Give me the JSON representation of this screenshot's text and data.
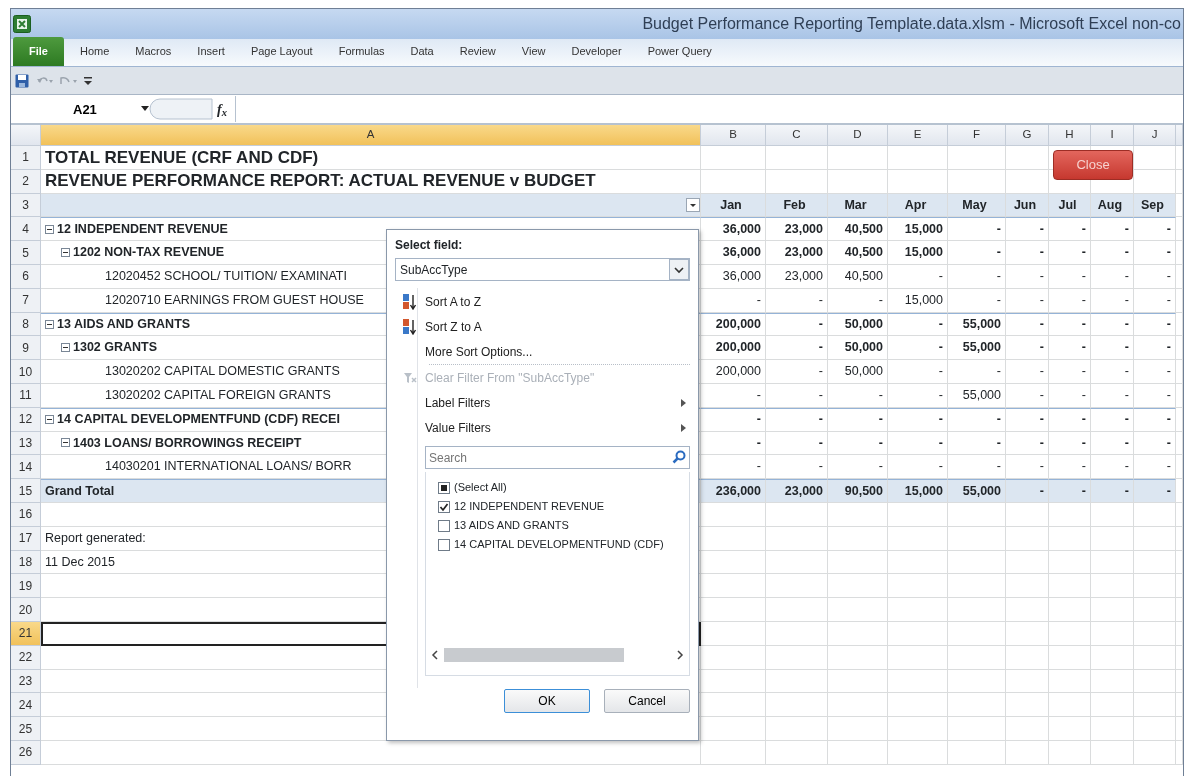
{
  "window": {
    "title": "Budget Performance Reporting Template.data.xlsm  -  Microsoft Excel non-co"
  },
  "ribbon_tabs": [
    {
      "label": "File",
      "selected": true
    },
    {
      "label": "Home",
      "selected": false
    },
    {
      "label": "Macros",
      "selected": false
    },
    {
      "label": "Insert",
      "selected": false
    },
    {
      "label": "Page Layout",
      "selected": false
    },
    {
      "label": "Formulas",
      "selected": false
    },
    {
      "label": "Data",
      "selected": false
    },
    {
      "label": "Review",
      "selected": false
    },
    {
      "label": "View",
      "selected": false
    },
    {
      "label": "Developer",
      "selected": false
    },
    {
      "label": "Power Query",
      "selected": false
    }
  ],
  "formula_bar": {
    "name_box": "A21",
    "function_label": "f$_{x}$"
  },
  "sheet": {
    "column_headers": [
      {
        "label": "A",
        "selected": true
      },
      {
        "label": "B",
        "selected": false
      },
      {
        "label": "C",
        "selected": false
      },
      {
        "label": "D",
        "selected": false
      },
      {
        "label": "E",
        "selected": false
      },
      {
        "label": "F",
        "selected": false
      },
      {
        "label": "G",
        "selected": false
      },
      {
        "label": "H",
        "selected": false
      },
      {
        "label": "I",
        "selected": false
      },
      {
        "label": "J",
        "selected": false
      }
    ],
    "row_headers": [
      {
        "label": "1",
        "selected": false
      },
      {
        "label": "2",
        "selected": false
      },
      {
        "label": "3",
        "selected": false
      },
      {
        "label": "4",
        "selected": false
      },
      {
        "label": "5",
        "selected": false
      },
      {
        "label": "6",
        "selected": false
      },
      {
        "label": "7",
        "selected": false
      },
      {
        "label": "8",
        "selected": false
      },
      {
        "label": "9",
        "selected": false
      },
      {
        "label": "10",
        "selected": false
      },
      {
        "label": "11",
        "selected": false
      },
      {
        "label": "12",
        "selected": false
      },
      {
        "label": "13",
        "selected": false
      },
      {
        "label": "14",
        "selected": false
      },
      {
        "label": "15",
        "selected": false
      },
      {
        "label": "16",
        "selected": false
      },
      {
        "label": "17",
        "selected": false
      },
      {
        "label": "18",
        "selected": false
      },
      {
        "label": "19",
        "selected": false
      },
      {
        "label": "20",
        "selected": false
      },
      {
        "label": "21",
        "selected": true
      },
      {
        "label": "22",
        "selected": false
      },
      {
        "label": "23",
        "selected": false
      },
      {
        "label": "24",
        "selected": false
      },
      {
        "label": "25",
        "selected": false
      },
      {
        "label": "26",
        "selected": false
      }
    ],
    "titles": [
      "TOTAL REVENUE (CRF AND CDF)",
      "REVENUE PERFORMANCE REPORT: ACTUAL REVENUE v BUDGET"
    ],
    "close_button": "Close",
    "pivot": {
      "months": [
        "Jan",
        "Feb",
        "Mar",
        "Apr",
        "May",
        "Jun",
        "Jul",
        "Aug",
        "Sep"
      ],
      "items": [
        {
          "label": "12  INDEPENDENT REVENUE",
          "expanded": true,
          "values": [
            "36,000",
            "23,000",
            "40,500",
            "15,000",
            "-",
            "-",
            "-",
            "-",
            "-"
          ],
          "children": [
            {
              "label": "1202  NON-TAX REVENUE",
              "expanded": true,
              "values": [
                "36,000",
                "23,000",
                "40,500",
                "15,000",
                "-",
                "-",
                "-",
                "-",
                "-"
              ],
              "children": [
                {
                  "label": "12020452  SCHOOL/ TUITION/ EXAMINATI",
                  "values": [
                    "36,000",
                    "23,000",
                    "40,500",
                    "-",
                    "-",
                    "-",
                    "-",
                    "-",
                    "-"
                  ]
                },
                {
                  "label": "12020710  EARNINGS FROM GUEST HOUSE",
                  "values": [
                    "-",
                    "-",
                    "-",
                    "15,000",
                    "-",
                    "-",
                    "-",
                    "-",
                    "-"
                  ]
                }
              ]
            }
          ]
        },
        {
          "label": "13  AIDS AND GRANTS",
          "expanded": true,
          "values": [
            "200,000",
            "-",
            "50,000",
            "-",
            "55,000",
            "-",
            "-",
            "-",
            "-"
          ],
          "children": [
            {
              "label": "1302  GRANTS",
              "expanded": true,
              "values": [
                "200,000",
                "-",
                "50,000",
                "-",
                "55,000",
                "-",
                "-",
                "-",
                "-"
              ],
              "children": [
                {
                  "label": "13020202  CAPITAL DOMESTIC GRANTS",
                  "values": [
                    "200,000",
                    "-",
                    "50,000",
                    "-",
                    "-",
                    "-",
                    "-",
                    "-",
                    "-"
                  ]
                },
                {
                  "label": "13020202  CAPITAL FOREIGN GRANTS",
                  "values": [
                    "-",
                    "-",
                    "-",
                    "-",
                    "55,000",
                    "-",
                    "-",
                    "-",
                    "-"
                  ]
                }
              ]
            }
          ]
        },
        {
          "label": "14  CAPITAL DEVELOPMENTFUND (CDF) RECEI",
          "expanded": true,
          "values": [
            "-",
            "-",
            "-",
            "-",
            "-",
            "-",
            "-",
            "-",
            "-"
          ],
          "children": [
            {
              "label": "1403  LOANS/ BORROWINGS RECEIPT",
              "expanded": true,
              "values": [
                "-",
                "-",
                "-",
                "-",
                "-",
                "-",
                "-",
                "-",
                "-"
              ],
              "children": [
                {
                  "label": "14030201  INTERNATIONAL LOANS/ BORR",
                  "values": [
                    "-",
                    "-",
                    "-",
                    "-",
                    "-",
                    "-",
                    "-",
                    "-",
                    "-"
                  ]
                }
              ]
            }
          ]
        }
      ],
      "grand_total": {
        "label": "Grand Total",
        "values": [
          "236,000",
          "23,000",
          "90,500",
          "15,000",
          "55,000",
          "-",
          "-",
          "-",
          "-"
        ]
      }
    },
    "notes": [
      "Report generated:",
      "11 Dec 2015"
    ]
  },
  "filter_menu": {
    "field_label": "Select field:",
    "field_value": "SubAccType",
    "commands": [
      {
        "kind": "sort_az",
        "label": "Sort A to Z",
        "disabled": false,
        "separator_after": false
      },
      {
        "kind": "sort_za",
        "label": "Sort Z to A",
        "disabled": false,
        "separator_after": false
      },
      {
        "kind": "plain",
        "label": "More Sort Options...",
        "disabled": false,
        "separator_after": true
      },
      {
        "kind": "clear",
        "label": "Clear Filter From \"SubAccType\"",
        "disabled": true,
        "separator_after": false
      },
      {
        "kind": "submenu",
        "label": "Label Filters",
        "disabled": false,
        "separator_after": false
      },
      {
        "kind": "submenu",
        "label": "Value Filters",
        "disabled": false,
        "separator_after": false
      }
    ],
    "search": {
      "placeholder": "Search"
    },
    "checklist": [
      {
        "label": "(Select All)",
        "checked": false,
        "partial": true
      },
      {
        "label": "12  INDEPENDENT REVENUE",
        "checked": true,
        "partial": false
      },
      {
        "label": "13  AIDS AND GRANTS",
        "checked": false,
        "partial": false
      },
      {
        "label": "14  CAPITAL DEVELOPMENTFUND (CDF)",
        "checked": false,
        "partial": false
      }
    ],
    "buttons": [
      {
        "label": "OK",
        "default": true
      },
      {
        "label": "Cancel",
        "default": false
      }
    ]
  }
}
